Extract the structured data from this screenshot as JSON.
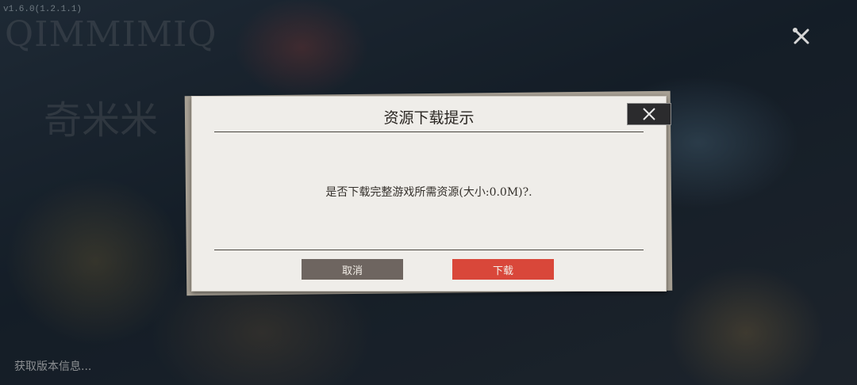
{
  "version": "v1.6.0(1.2.1.1)",
  "logo": {
    "en": "QIMMIMIQ",
    "cn": "奇米米"
  },
  "dialog": {
    "title": "资源下载提示",
    "message": "是否下载完整游戏所需资源(大小:0.0M)?.",
    "cancel_label": "取消",
    "download_label": "下载"
  },
  "status_text": "获取版本信息...",
  "icons": {
    "close": "close-icon",
    "tools": "tools-icon"
  },
  "colors": {
    "cancel": "#6e6560",
    "download": "#d9473a",
    "panel": "#efede9"
  }
}
